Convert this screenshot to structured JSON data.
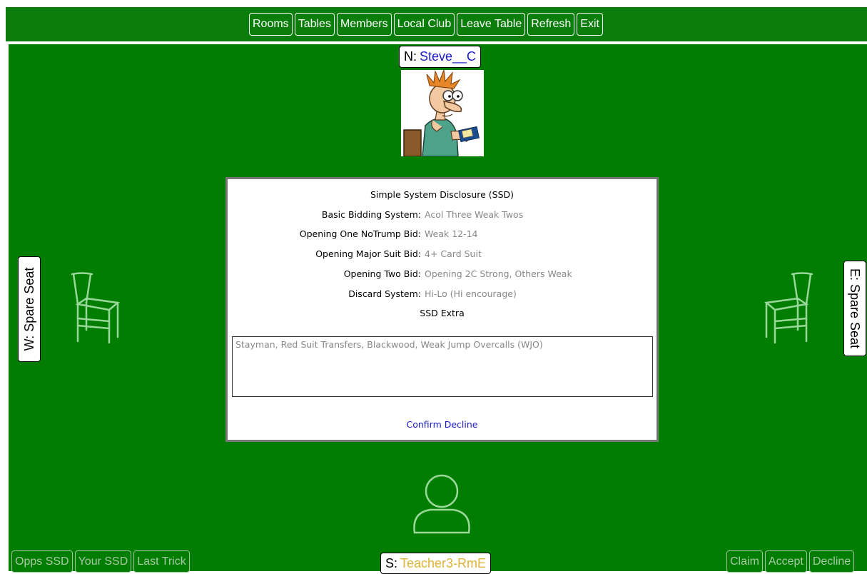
{
  "top_nav": {
    "items": [
      "Rooms",
      "Tables",
      "Members",
      "Local Club",
      "Leave Table",
      "Refresh",
      "Exit"
    ]
  },
  "seats": {
    "north": {
      "prefix": "N:",
      "name": "Steve__C"
    },
    "south": {
      "prefix": "S:",
      "name": "Teacher3-RmE"
    },
    "west": {
      "label": "W: Spare Seat"
    },
    "east": {
      "label": "E: Spare Seat"
    }
  },
  "ssd": {
    "title": "Simple System Disclosure (SSD)",
    "rows": [
      {
        "key": "Basic Bidding System:",
        "value": "Acol Three Weak Twos"
      },
      {
        "key": "Opening One NoTrump Bid:",
        "value": "Weak 12-14"
      },
      {
        "key": "Opening Major Suit Bid:",
        "value": "4+ Card Suit"
      },
      {
        "key": "Opening Two Bid:",
        "value": "Opening 2C Strong, Others Weak"
      },
      {
        "key": "Discard System:",
        "value": "Hi-Lo (Hi encourage)"
      }
    ],
    "extra_title": "SSD Extra",
    "extra_text": "Stayman, Red Suit Transfers, Blackwood, Weak Jump Overcalls (WJO)",
    "confirm_label": "Confirm Decline"
  },
  "bottom_left": {
    "items": [
      "Opps SSD",
      "Your SSD",
      "Last Trick"
    ]
  },
  "bottom_right": {
    "items": [
      "Claim",
      "Accept",
      "Decline"
    ]
  },
  "colors": {
    "felt": "#017e01",
    "north_name": "#1a1ad0",
    "south_name": "#e0b43a",
    "ssd_value": "#888888",
    "confirm_link": "#1a1ad0"
  },
  "icons": {
    "north_avatar": "cartoon-player-avatar",
    "west_seat": "empty-chair-icon",
    "east_seat": "empty-chair-icon",
    "south_avatar": "person-placeholder-icon"
  }
}
